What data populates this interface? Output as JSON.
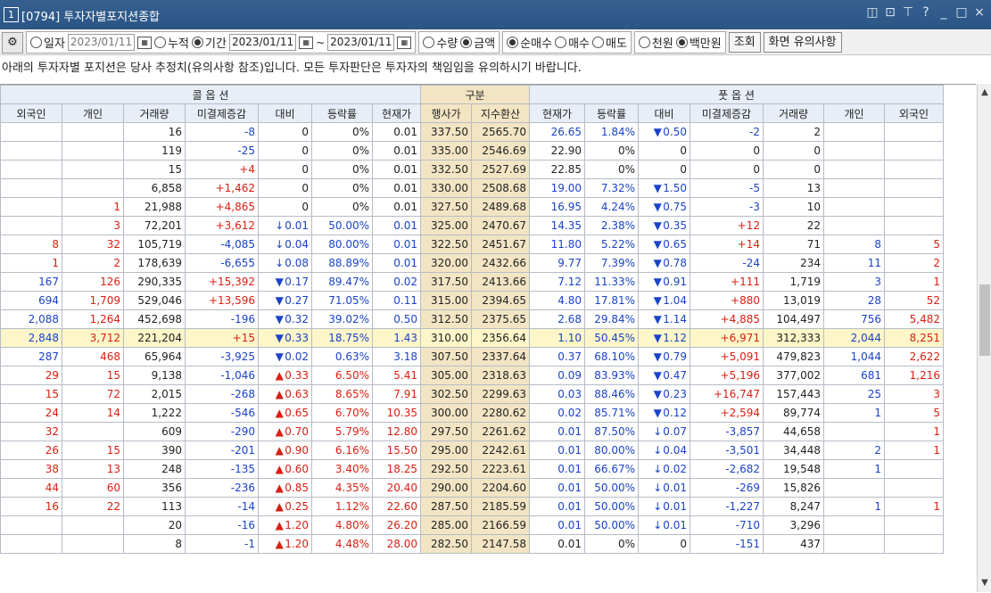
{
  "window": {
    "badge": "1",
    "title": "[0794] 투자자별포지션종합"
  },
  "toolbar": {
    "gear_icon": "gear-icon",
    "radio_daily": "일자",
    "date_single": "2023/01/11",
    "radio_cumulative": "누적",
    "radio_period": "기간",
    "date_from": "2023/01/11",
    "tilde": "~",
    "date_to": "2023/01/11",
    "radio_qty": "수량",
    "radio_amount": "금액",
    "radio_net_buy": "순매수",
    "radio_buy": "매수",
    "radio_sell": "매도",
    "radio_thousand": "천원",
    "radio_million": "백만원",
    "query_button": "조회",
    "notice_button": "화면 유의사항"
  },
  "notice": "아래의 투자자별 포지션은 당사 추정치(유의사항 참조)입니다. 모든 투자판단은 투자자의 책임임을 유의하시기 바랍니다.",
  "table": {
    "group_call": "콜 옵 션",
    "group_mid": "구분",
    "group_put": "풋 옵 션",
    "columns": [
      "외국인",
      "개인",
      "거래량",
      "미결제증감",
      "대비",
      "등락률",
      "현재가",
      "행사가",
      "지수환산",
      "현재가",
      "등락률",
      "대비",
      "미결제증감",
      "거래량",
      "개인",
      "외국인"
    ],
    "rows": [
      [
        "",
        "",
        "16",
        "-8",
        "",
        "0",
        "0%",
        "0.01",
        "337.50",
        "2565.70",
        "26.65",
        "1.84%",
        "down",
        "0.50",
        "-2",
        "2",
        "",
        ""
      ],
      [
        "",
        "",
        "119",
        "-25",
        "",
        "0",
        "0%",
        "0.01",
        "335.00",
        "2546.69",
        "22.90",
        "0%",
        "",
        "0",
        "0",
        "0",
        "",
        ""
      ],
      [
        "",
        "",
        "15",
        "+4",
        "",
        "0",
        "0%",
        "0.01",
        "332.50",
        "2527.69",
        "22.85",
        "0%",
        "",
        "0",
        "0",
        "0",
        "",
        ""
      ],
      [
        "",
        "",
        "6,858",
        "+1,462",
        "",
        "0",
        "0%",
        "0.01",
        "330.00",
        "2508.68",
        "19.00",
        "7.32%",
        "down",
        "1.50",
        "-5",
        "13",
        "",
        ""
      ],
      [
        "",
        "1",
        "21,988",
        "+4,865",
        "",
        "0",
        "0%",
        "0.01",
        "327.50",
        "2489.68",
        "16.95",
        "4.24%",
        "down",
        "0.75",
        "-3",
        "10",
        "",
        ""
      ],
      [
        "",
        "3",
        "72,201",
        "+3,612",
        "dn",
        "0.01",
        "50.00%",
        "0.01",
        "325.00",
        "2470.67",
        "14.35",
        "2.38%",
        "down",
        "0.35",
        "+12",
        "22",
        "",
        ""
      ],
      [
        "8",
        "32",
        "105,719",
        "-4,085",
        "dn",
        "0.04",
        "80.00%",
        "0.01",
        "322.50",
        "2451.67",
        "11.80",
        "5.22%",
        "down",
        "0.65",
        "+14",
        "71",
        "8",
        "5"
      ],
      [
        "1",
        "2",
        "178,639",
        "-6,655",
        "dn",
        "0.08",
        "88.89%",
        "0.01",
        "320.00",
        "2432.66",
        "9.77",
        "7.39%",
        "down",
        "0.78",
        "-24",
        "234",
        "11",
        "2"
      ],
      [
        "167",
        "126",
        "290,335",
        "+15,392",
        "down",
        "0.17",
        "89.47%",
        "0.02",
        "317.50",
        "2413.66",
        "7.12",
        "11.33%",
        "down",
        "0.91",
        "+111",
        "1,719",
        "3",
        "1"
      ],
      [
        "694",
        "1,709",
        "529,046",
        "+13,596",
        "down",
        "0.27",
        "71.05%",
        "0.11",
        "315.00",
        "2394.65",
        "4.80",
        "17.81%",
        "down",
        "1.04",
        "+880",
        "13,019",
        "28",
        "52"
      ],
      [
        "2,088",
        "1,264",
        "452,698",
        "-196",
        "down",
        "0.32",
        "39.02%",
        "0.50",
        "312.50",
        "2375.65",
        "2.68",
        "29.84%",
        "down",
        "1.14",
        "+4,885",
        "104,497",
        "756",
        "5,482"
      ],
      [
        "2,848",
        "3,712",
        "221,204",
        "+15",
        "down",
        "0.33",
        "18.75%",
        "1.43",
        "310.00",
        "2356.64",
        "1.10",
        "50.45%",
        "down",
        "1.12",
        "+6,971",
        "312,333",
        "2,044",
        "8,251"
      ],
      [
        "287",
        "468",
        "65,964",
        "-3,925",
        "down",
        "0.02",
        "0.63%",
        "3.18",
        "307.50",
        "2337.64",
        "0.37",
        "68.10%",
        "down",
        "0.79",
        "+5,091",
        "479,823",
        "1,044",
        "2,622"
      ],
      [
        "29",
        "15",
        "9,138",
        "-1,046",
        "up",
        "0.33",
        "6.50%",
        "5.41",
        "305.00",
        "2318.63",
        "0.09",
        "83.93%",
        "down",
        "0.47",
        "+5,196",
        "377,002",
        "681",
        "1,216"
      ],
      [
        "15",
        "72",
        "2,015",
        "-268",
        "up",
        "0.63",
        "8.65%",
        "7.91",
        "302.50",
        "2299.63",
        "0.03",
        "88.46%",
        "down",
        "0.23",
        "+16,747",
        "157,443",
        "25",
        "3"
      ],
      [
        "24",
        "14",
        "1,222",
        "-546",
        "up",
        "0.65",
        "6.70%",
        "10.35",
        "300.00",
        "2280.62",
        "0.02",
        "85.71%",
        "down",
        "0.12",
        "+2,594",
        "89,774",
        "1",
        "5"
      ],
      [
        "32",
        "",
        "609",
        "-290",
        "up",
        "0.70",
        "5.79%",
        "12.80",
        "297.50",
        "2261.62",
        "0.01",
        "87.50%",
        "dn",
        "0.07",
        "-3,857",
        "44,658",
        "",
        "1"
      ],
      [
        "26",
        "15",
        "390",
        "-201",
        "up",
        "0.90",
        "6.16%",
        "15.50",
        "295.00",
        "2242.61",
        "0.01",
        "80.00%",
        "dn",
        "0.04",
        "-3,501",
        "34,448",
        "2",
        "1"
      ],
      [
        "38",
        "13",
        "248",
        "-135",
        "up",
        "0.60",
        "3.40%",
        "18.25",
        "292.50",
        "2223.61",
        "0.01",
        "66.67%",
        "dn",
        "0.02",
        "-2,682",
        "19,548",
        "1",
        ""
      ],
      [
        "44",
        "60",
        "356",
        "-236",
        "up",
        "0.85",
        "4.35%",
        "20.40",
        "290.00",
        "2204.60",
        "0.01",
        "50.00%",
        "dn",
        "0.01",
        "-269",
        "15,826",
        "",
        ""
      ],
      [
        "16",
        "22",
        "113",
        "-14",
        "up",
        "0.25",
        "1.12%",
        "22.60",
        "287.50",
        "2185.59",
        "0.01",
        "50.00%",
        "dn",
        "0.01",
        "-1,227",
        "8,247",
        "1",
        "1"
      ],
      [
        "",
        "",
        "20",
        "-16",
        "up",
        "1.20",
        "4.80%",
        "26.20",
        "285.00",
        "2166.59",
        "0.01",
        "50.00%",
        "dn",
        "0.01",
        "-710",
        "3,296",
        "",
        ""
      ],
      [
        "",
        "",
        "8",
        "-1",
        "up",
        "1.20",
        "4.48%",
        "28.00",
        "282.50",
        "2147.58",
        "0.01",
        "0%",
        "",
        "0",
        "-151",
        "437",
        "",
        ""
      ]
    ]
  },
  "colors": {
    "title_bg": "#2b5585",
    "header_bg": "#e8eef7",
    "band_bg": "#f3e5c4",
    "highlight_row": "#fdf6c8",
    "up": "#d91f11",
    "down": "#1b43c8"
  }
}
